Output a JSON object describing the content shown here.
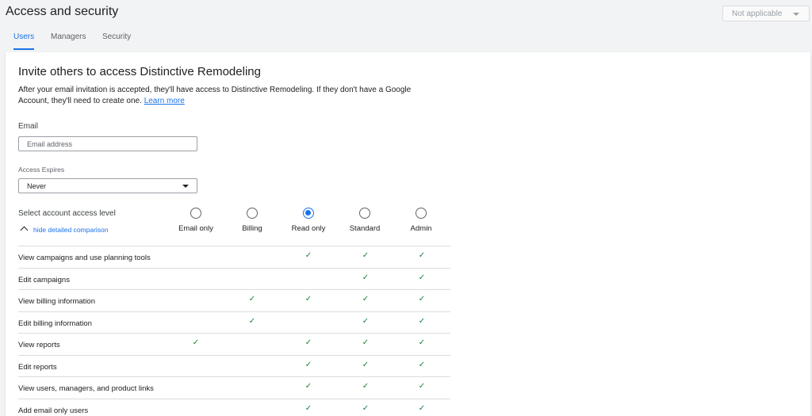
{
  "header": {
    "title": "Access and security",
    "scope_value": "Not applicable"
  },
  "tabs": [
    {
      "label": "Users",
      "active": true
    },
    {
      "label": "Managers",
      "active": false
    },
    {
      "label": "Security",
      "active": false
    }
  ],
  "invite": {
    "heading": "Invite others to access Distinctive Remodeling",
    "intro": "After your email invitation is accepted, they'll have access to Distinctive Remodeling. If they don't have a Google Account, they'll need to create one.",
    "learn_more": "Learn more",
    "email_label": "Email",
    "email_placeholder": "Email address",
    "email_value": "",
    "expires_label": "Access Expires",
    "expires_value": "Never",
    "access_level_label": "Select account access level",
    "toggle_comparison": "hide detailed comparison",
    "levels": [
      {
        "name": "Email only",
        "selected": false
      },
      {
        "name": "Billing",
        "selected": false
      },
      {
        "name": "Read only",
        "selected": true
      },
      {
        "name": "Standard",
        "selected": false
      },
      {
        "name": "Admin",
        "selected": false
      }
    ],
    "check_symbol": "✓",
    "permissions": [
      {
        "label": "View campaigns and use planning tools",
        "levels": [
          false,
          false,
          true,
          true,
          true
        ]
      },
      {
        "label": "Edit campaigns",
        "levels": [
          false,
          false,
          false,
          true,
          true
        ]
      },
      {
        "label": "View billing information",
        "levels": [
          false,
          true,
          true,
          true,
          true
        ]
      },
      {
        "label": "Edit billing information",
        "levels": [
          false,
          true,
          false,
          true,
          true
        ]
      },
      {
        "label": "View reports",
        "levels": [
          true,
          false,
          true,
          true,
          true
        ]
      },
      {
        "label": "Edit reports",
        "levels": [
          false,
          false,
          true,
          true,
          true
        ]
      },
      {
        "label": "View users, managers, and product links",
        "levels": [
          false,
          false,
          true,
          true,
          true
        ]
      },
      {
        "label": "Add email only users",
        "levels": [
          false,
          false,
          true,
          true,
          true
        ]
      }
    ]
  },
  "colors": {
    "accent": "#1a73e8",
    "check": "#188038",
    "background": "#f1f3f4"
  }
}
